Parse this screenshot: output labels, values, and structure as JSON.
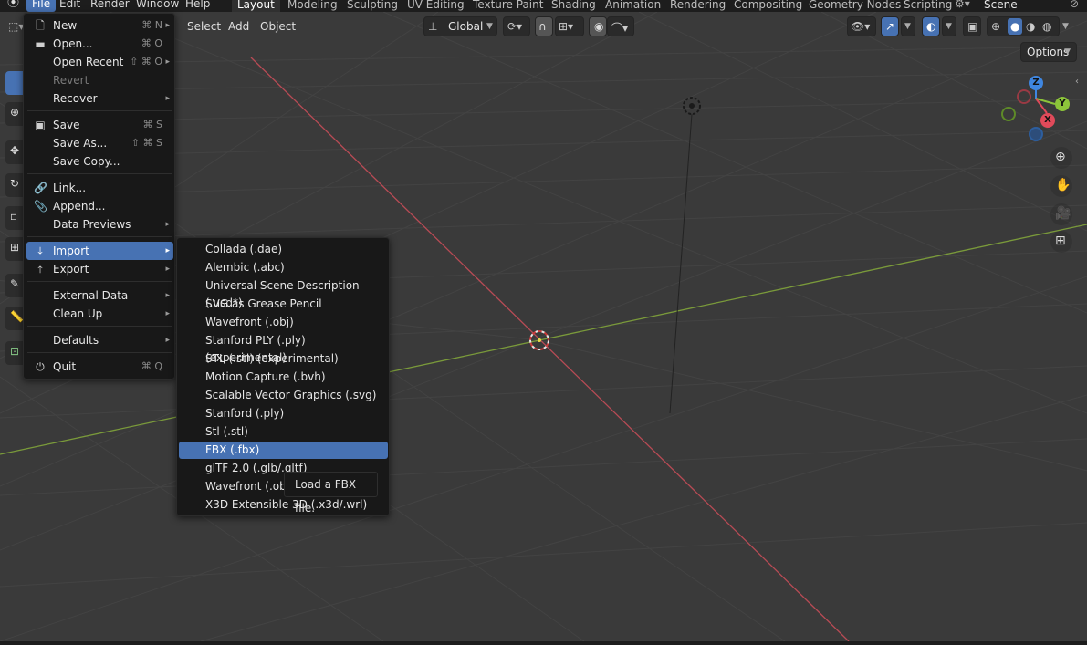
{
  "topbar": {
    "menus": [
      "File",
      "Edit",
      "Render",
      "Window",
      "Help"
    ],
    "workspaces": [
      "Layout",
      "Modeling",
      "Sculpting",
      "UV Editing",
      "Texture Paint",
      "Shading",
      "Animation",
      "Rendering",
      "Compositing",
      "Geometry Nodes",
      "Scripting"
    ],
    "active_workspace": "Layout",
    "scene_name": "Scene"
  },
  "viewport_header": {
    "select": "Select",
    "add": "Add",
    "object": "Object",
    "orientation": "Global",
    "options": "Options"
  },
  "gizmo": {
    "z": "Z",
    "y": "Y",
    "x": "X"
  },
  "file_menu": {
    "items": [
      {
        "label": "New",
        "shortcut": "⌘ N",
        "arrow": "▸",
        "icon": "new-file-icon"
      },
      {
        "label": "Open...",
        "shortcut": "⌘ O",
        "icon": "folder-icon"
      },
      {
        "label": "Open Recent",
        "shortcut": "⇧ ⌘ O",
        "arrow": "▸"
      },
      {
        "label": "Revert",
        "disabled": true
      },
      {
        "label": "Recover",
        "arrow": "▸"
      },
      {
        "label": "Save",
        "shortcut": "⌘ S",
        "icon": "save-icon"
      },
      {
        "label": "Save As...",
        "shortcut": "⇧ ⌘ S"
      },
      {
        "label": "Save Copy..."
      },
      {
        "label": "Link...",
        "icon": "link-icon"
      },
      {
        "label": "Append...",
        "icon": "append-icon"
      },
      {
        "label": "Data Previews",
        "arrow": "▸"
      },
      {
        "label": "Import",
        "arrow": "▸",
        "icon": "import-icon"
      },
      {
        "label": "Export",
        "arrow": "▸",
        "icon": "export-icon"
      },
      {
        "label": "External Data",
        "arrow": "▸"
      },
      {
        "label": "Clean Up",
        "arrow": "▸"
      },
      {
        "label": "Defaults",
        "arrow": "▸"
      },
      {
        "label": "Quit",
        "shortcut": "⌘ Q",
        "icon": "power-icon"
      }
    ]
  },
  "import_menu": {
    "items": [
      "Collada (.dae)",
      "Alembic (.abc)",
      "Universal Scene Description (.usd*)",
      "SVG as Grease Pencil",
      "Wavefront (.obj)",
      "Stanford PLY (.ply) (experimental)",
      "STL (.stl) (experimental)",
      "Motion Capture (.bvh)",
      "Scalable Vector Graphics (.svg)",
      "Stanford (.ply)",
      "Stl (.stl)",
      "FBX (.fbx)",
      "glTF 2.0 (.glb/.gltf)",
      "Wavefront (.obj) (",
      "X3D Extensible 3D (.x3d/.wrl)"
    ],
    "highlighted": "FBX (.fbx)"
  },
  "tooltip": "Load a FBX file.",
  "colors": {
    "accent": "#4772b3",
    "x_axis": "#e04a5a",
    "y_axis": "#8cc43a",
    "z_axis": "#3f86e0"
  }
}
